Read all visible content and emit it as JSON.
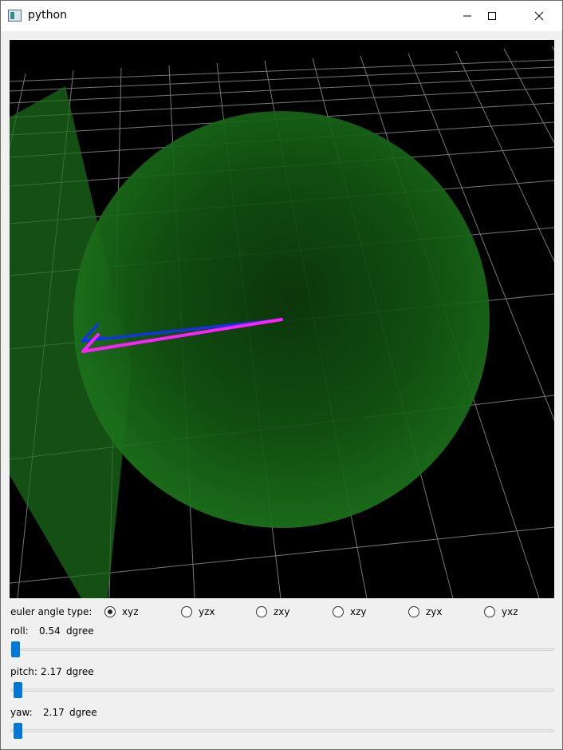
{
  "window": {
    "title": "python"
  },
  "controls": {
    "euler_label": "euler angle type:",
    "euler_options": [
      "xyz",
      "yzx",
      "zxy",
      "xzy",
      "zyx",
      "yxz"
    ],
    "selected": "xyz",
    "roll": {
      "name": "roll:",
      "value": "0.54",
      "unit": "dgree"
    },
    "pitch": {
      "name": "pitch:",
      "value": "2.17",
      "unit": "dgree"
    },
    "yaw": {
      "name": "yaw:",
      "value": "2.17",
      "unit": "dgree"
    }
  },
  "colors": {
    "sphere": "#1a7a1a",
    "plane": "#1c6e1c",
    "arrow_blue": "#1030ff",
    "arrow_magenta": "#ff20ff",
    "slider_accent": "#0078d7"
  }
}
